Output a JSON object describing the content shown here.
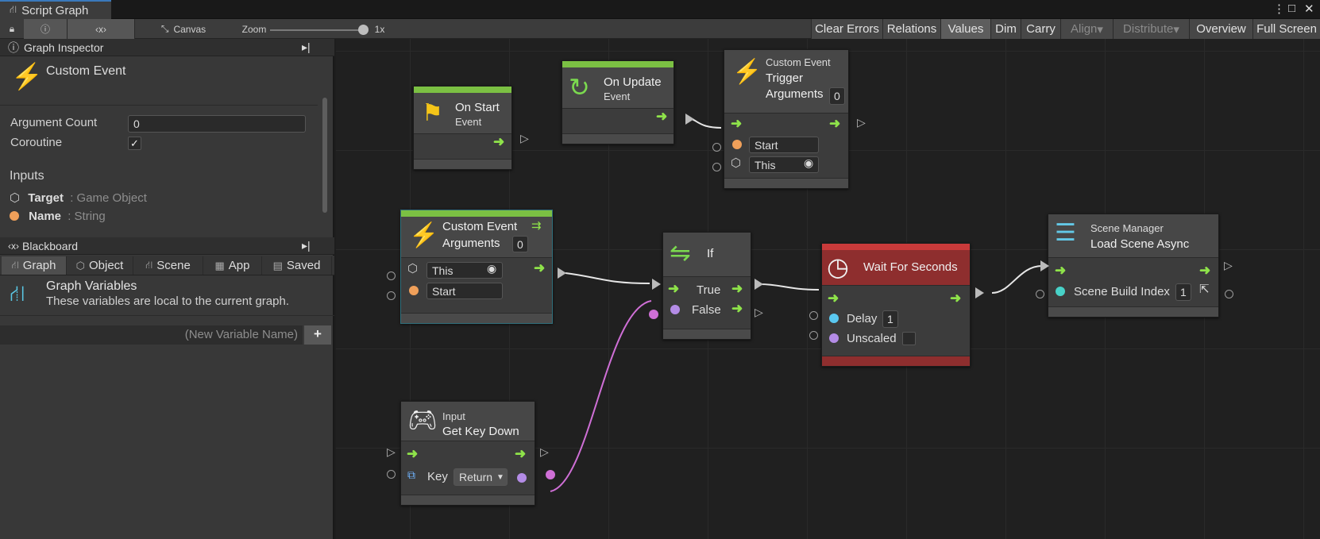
{
  "window": {
    "tab_title": "Script Graph"
  },
  "toolbar": {
    "canvas_label": "Canvas",
    "zoom_label": "Zoom",
    "zoom_value": "1x",
    "buttons": [
      "Clear Errors",
      "Relations",
      "Values",
      "Dim",
      "Carry",
      "Align",
      "Distribute",
      "Overview",
      "Full Screen"
    ]
  },
  "inspector": {
    "title": "Graph Inspector",
    "node_name": "Custom Event",
    "argument_count_label": "Argument Count",
    "argument_count_value": "0",
    "coroutine_label": "Coroutine",
    "coroutine_checked": true,
    "inputs_heading": "Inputs",
    "inputs": [
      {
        "name": "Target",
        "type": ": Game Object"
      },
      {
        "name": "Name",
        "type": ": String"
      }
    ]
  },
  "blackboard": {
    "title": "Blackboard",
    "tabs": [
      "Graph",
      "Object",
      "Scene",
      "App",
      "Saved"
    ],
    "section_title": "Graph Variables",
    "section_desc": "These variables are local to the current graph.",
    "new_var_placeholder": "(New Variable Name)",
    "add_label": "+"
  },
  "nodes": {
    "on_start": {
      "title": "On Start",
      "subtitle": "Event"
    },
    "on_update": {
      "title": "On Update",
      "subtitle": "Event"
    },
    "trigger": {
      "category": "Custom Event",
      "title": "Trigger",
      "args_label": "Arguments",
      "args_value": "0",
      "name_value": "Start",
      "target_value": "This"
    },
    "custom_event": {
      "title": "Custom Event",
      "args_label": "Arguments",
      "args_value": "0",
      "target_value": "This",
      "name_value": "Start"
    },
    "if": {
      "title": "If",
      "true_label": "True",
      "false_label": "False"
    },
    "wait": {
      "title": "Wait For Seconds",
      "delay_label": "Delay",
      "delay_value": "1",
      "unscaled_label": "Unscaled"
    },
    "load_scene": {
      "category": "Scene Manager",
      "title": "Load Scene Async",
      "index_label": "Scene Build Index",
      "index_value": "1"
    },
    "get_key": {
      "category": "Input",
      "title": "Get Key Down",
      "key_label": "Key",
      "key_value": "Return"
    }
  },
  "colors": {
    "event_bar": "#7bc043",
    "wait_header": "#a83232",
    "string_port": "#f0a05a",
    "bool_port": "#b48ce6",
    "float_port": "#5ac8f0",
    "int_port": "#48d2c8",
    "flow": "#8fe34a"
  }
}
